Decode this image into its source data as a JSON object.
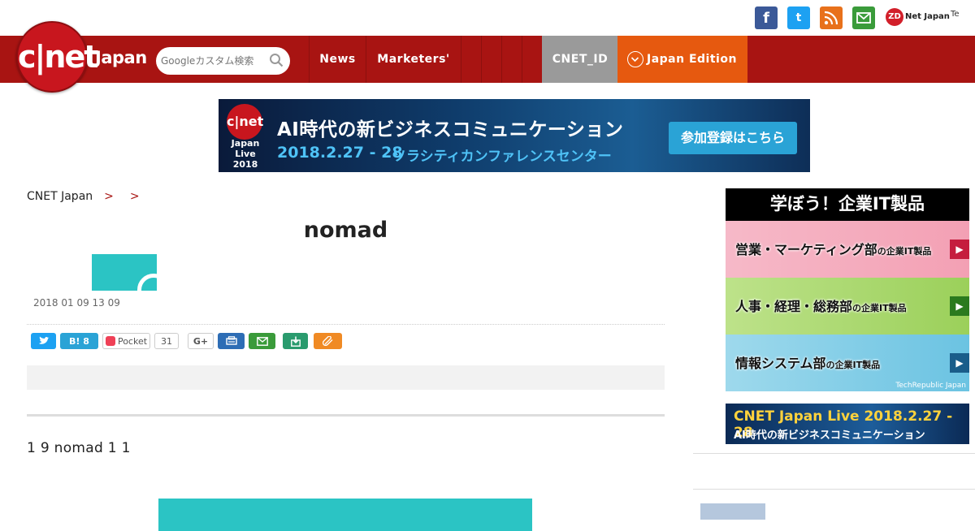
{
  "topbar": {
    "facebook_icon": "f",
    "twitter_icon": "t",
    "rss_icon": "rss",
    "mail_icon": "mail",
    "zdnet_logo": "ZD",
    "zdnet_text": "Net Japan",
    "techrepublic_text": "Te"
  },
  "header": {
    "logo_text": "c|net",
    "logo_japan": "Japan",
    "search_placeholder": "Googleカスタム検索",
    "nav": [
      "News",
      "Marketers'"
    ],
    "cnet_id": "CNET_ID",
    "edition": "Japan Edition"
  },
  "banner": {
    "logo_text": "c|net",
    "live_text": "Japan Live 2018",
    "title": "AI時代の新ビジネスコミュニケーション",
    "date": "2018.2.27 - 28",
    "venue": "ソラシティカンファレンスセンター",
    "button": "参加登録はこちら"
  },
  "breadcrumb": {
    "home": "CNET Japan",
    "level1": "",
    "level2": ""
  },
  "article": {
    "title": "nomad",
    "byline_author": "",
    "date": "2018 01 09 13 09",
    "hatena_count": "8",
    "pocket_label": "Pocket",
    "pocket_count": "31",
    "gplus_label": "G+",
    "body": "1 9 nomad 1 1"
  },
  "sidebar": {
    "ad_title": "学ぼう！企業IT製品",
    "rows": [
      {
        "label": "営業・マーケティング部",
        "suffix": "の企業IT製品"
      },
      {
        "label": "人事・経理・総務部",
        "suffix": "の企業IT製品"
      },
      {
        "label": "情報システム部",
        "suffix": "の企業IT製品"
      }
    ],
    "credit": "TechRepublic Japan",
    "live_banner_top": "CNET Japan Live 2018.2.27 - 28",
    "live_banner_bottom": "AI時代の新ビジネスコミュニケーション",
    "section_heading": "",
    "link_text": ""
  }
}
